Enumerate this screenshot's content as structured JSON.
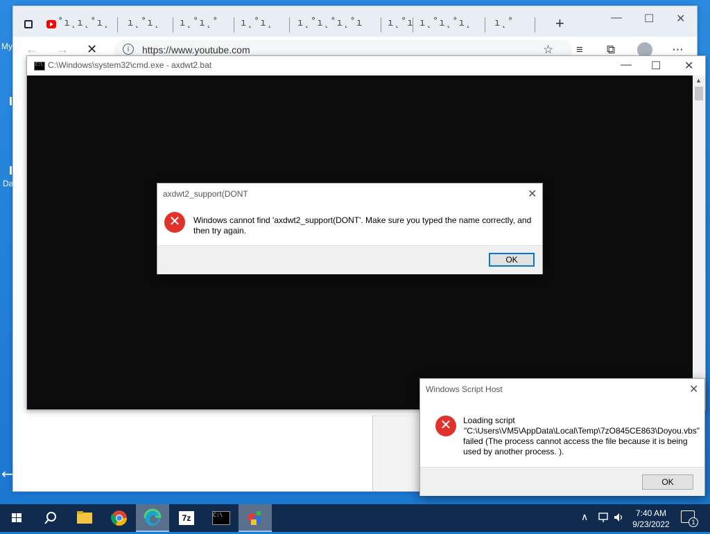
{
  "desktop": {
    "labels": [
      "My",
      "Da"
    ]
  },
  "browser": {
    "tabs_glitched": [
      "˚ı˛ı˛˚ı˛",
      "ı˛˚ı˛",
      "ı˛˚ı˛˚",
      "ı˛˚ı˛",
      "ı˛˚ı˛˚ı˛˚ı",
      "ı˛˚ı",
      "ı˛˚ı˛˚ı˛",
      "ı˛˚"
    ],
    "new_tab": "+",
    "minimize": "—",
    "maximize": "☐",
    "close": "✕",
    "url": "https://www.youtube.com",
    "nav": {
      "back": "←",
      "forward": "→",
      "stop": "✕"
    },
    "toolbar_icons": {
      "fav_add": "☆",
      "favorites": "≡",
      "collections": "⧉",
      "more": "⋯"
    }
  },
  "cmd": {
    "title": "C:\\Windows\\system32\\cmd.exe - axdwt2.bat",
    "minimize": "—",
    "maximize": "☐",
    "close": "✕",
    "scroll_up": "▲"
  },
  "dialog1": {
    "title": "axdwt2_support(DONT",
    "close": "✕",
    "icon": "✕",
    "message": "Windows cannot find 'axdwt2_support(DONT'. Make sure you typed the name correctly, and then try again.",
    "ok": "OK"
  },
  "dialog2": {
    "title": "Windows Script Host",
    "close": "✕",
    "icon": "✕",
    "message_line1": "Loading script",
    "message_line2": "\"C:\\Users\\VM5\\AppData\\Local\\Temp\\7zO845CE863\\Doyou.vbs\"",
    "message_line3": "failed (The process cannot access the file because it is being used by another process. ).",
    "ok": "OK"
  },
  "taskbar": {
    "search": "⚲",
    "tray_chevron": "∧",
    "time": "7:40 AM",
    "date": "9/23/2022",
    "notification_count": "1",
    "cmd_icon_text": "C:\\",
    "sevenzip_text": "7z",
    "colors": {
      "background": "#112b4e",
      "active_item": "#5a6f8c"
    }
  }
}
